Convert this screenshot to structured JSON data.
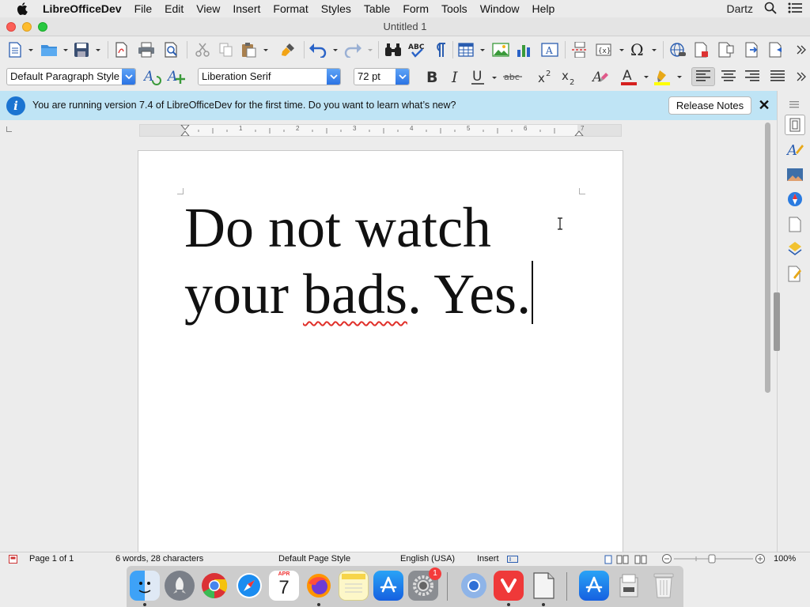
{
  "menubar": {
    "app_name": "LibreOfficeDev",
    "items": [
      "File",
      "Edit",
      "View",
      "Insert",
      "Format",
      "Styles",
      "Table",
      "Form",
      "Tools",
      "Window",
      "Help"
    ],
    "user": "Dartz"
  },
  "window": {
    "title": "Untitled 1"
  },
  "toolbar2": {
    "paragraph_style": "Default Paragraph Style",
    "font_name": "Liberation Serif",
    "font_size": "72 pt",
    "font_color": "#d6201e",
    "highlight_color": "#ffff00"
  },
  "infobar": {
    "message": "You are running version 7.4 of LibreOfficeDev for the first time. Do you want to learn what’s new?",
    "release_notes_label": "Release Notes",
    "close_glyph": "✕",
    "info_glyph": "i"
  },
  "document": {
    "line1": "Do not watch",
    "line2_pre": "your ",
    "line2_misspelled": "bads",
    "line2_post": ". Yes."
  },
  "ruler": {
    "numbers": [
      "1",
      "2",
      "3",
      "4",
      "5",
      "6",
      "7"
    ]
  },
  "statusbar": {
    "page": "Page 1 of 1",
    "word_count": "6 words, 28 characters",
    "page_style": "Default Page Style",
    "language": "English (USA)",
    "insert_mode": "Insert",
    "zoom": "100%"
  },
  "dock": {
    "calendar_month": "APR",
    "calendar_day": "7",
    "prefs_badge": "1"
  },
  "colors": {
    "accent": "#2b73e4",
    "infobar_bg": "#bfe4f5",
    "spell_error": "#e0302a"
  }
}
